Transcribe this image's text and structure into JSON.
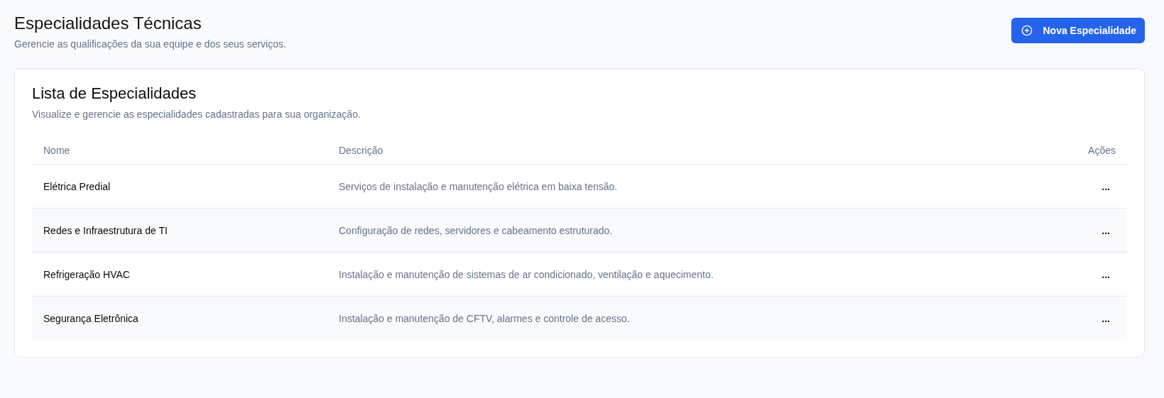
{
  "header": {
    "title": "Especialidades Técnicas",
    "subtitle": "Gerencie as qualificações da sua equipe e dos seus serviços.",
    "action_button": "Nova Especialidade"
  },
  "card": {
    "title": "Lista de Especialidades",
    "subtitle": "Visualize e gerencie as especialidades cadastradas para sua organização.",
    "table": {
      "columns": [
        "Nome",
        "Descrição",
        "Ações"
      ],
      "rows": [
        {
          "name": "Elétrica Predial",
          "description": "Serviços de instalação e manutenção elétrica em baixa tensão.",
          "actions": "..."
        },
        {
          "name": "Redes e Infraestrutura de TI",
          "description": "Configuração de redes, servidores e cabeamento estruturado.",
          "actions": "..."
        },
        {
          "name": "Refrigeração HVAC",
          "description": "Instalação e manutenção de sistemas de ar condicionado, ventilação e aquecimento.",
          "actions": "..."
        },
        {
          "name": "Segurança Eletrônica",
          "description": "Instalação e manutenção de CFTV, alarmes e controle de acesso.",
          "actions": "..."
        }
      ]
    }
  }
}
